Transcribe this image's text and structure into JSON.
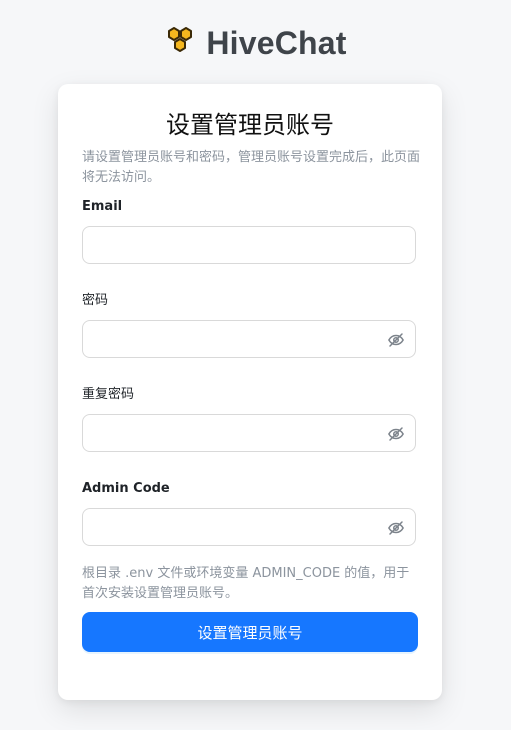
{
  "brand": {
    "name": "HiveChat",
    "logo_icon": "honeycomb-logo-icon",
    "logo_fill": "#f5b71e",
    "logo_stroke": "#3b2a07"
  },
  "form": {
    "title": "设置管理员账号",
    "description": "请设置管理员账号和密码，管理员账号设置完成后，此页面将无法访问。",
    "fields": {
      "email": {
        "label": "Email",
        "value": "",
        "placeholder": ""
      },
      "password": {
        "label": "密码",
        "value": "",
        "placeholder": "",
        "icon": "eye-off-icon"
      },
      "repeat_password": {
        "label": "重复密码",
        "value": "",
        "placeholder": "",
        "icon": "eye-off-icon"
      },
      "admin_code": {
        "label": "Admin Code",
        "value": "",
        "placeholder": "",
        "icon": "eye-off-icon"
      }
    },
    "hint": "根目录 .env 文件或环境变量 ADMIN_CODE 的值，用于首次安装设置管理员账号。",
    "submit_label": "设置管理员账号"
  },
  "colors": {
    "background": "#f6f7f9",
    "card": "#ffffff",
    "primary": "#1677ff",
    "muted_text": "#8c949e",
    "border": "#d9d9d9"
  }
}
